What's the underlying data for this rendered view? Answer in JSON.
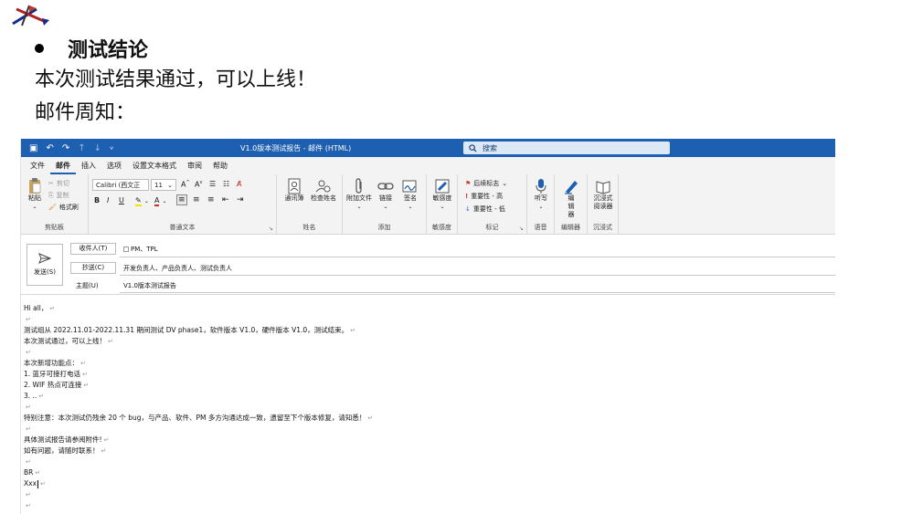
{
  "slide": {
    "bullet": "测试结论",
    "line1": "本次测试结果通过，可以上线！",
    "line2": "邮件周知："
  },
  "window": {
    "title": "V1.0版本测试报告 - 邮件 (HTML)",
    "search_placeholder": "搜索",
    "titlebar_color": "#1d5fb0"
  },
  "menu": {
    "tabs": [
      "文件",
      "邮件",
      "插入",
      "选项",
      "设置文本格式",
      "审阅",
      "帮助"
    ],
    "active": "邮件"
  },
  "ribbon": {
    "clipboard": {
      "paste": "粘贴",
      "cut": "剪切",
      "copy": "复制",
      "format_painter": "格式刷",
      "label": "剪贴板"
    },
    "font": {
      "font_name": "Calibri (西文正",
      "font_size": "11",
      "label": "普通文本"
    },
    "names": {
      "address_book": "通讯簿",
      "check_names": "检查姓名",
      "label": "姓名"
    },
    "include": {
      "attach": "附加文件",
      "link": "链接",
      "signature": "签名",
      "label": "添加"
    },
    "sensitivity": {
      "button": "敏感度",
      "label": "敏感度"
    },
    "tags": {
      "follow_up": "后续标志",
      "high": "重要性 - 高",
      "low": "重要性 - 低",
      "label": "标记"
    },
    "voice": {
      "dictate": "听写",
      "label": "语音"
    },
    "editor": {
      "button": "编辑器",
      "label": "编辑器"
    },
    "immersive": {
      "button": "沉浸式阅读器",
      "label": "沉浸式"
    }
  },
  "compose": {
    "send": "发送(S)",
    "to_label": "收件人(T)",
    "to_value": "PM、TPL",
    "cc_label": "抄送(C)",
    "cc_value": "开发负责人、产品负责人、测试负责人",
    "subject_label": "主题(U)",
    "subject_value": "V1.0版本测试报告"
  },
  "body": {
    "lines": [
      "Hi all，",
      "",
      "测试组从 2022.11.01-2022.11.31 期间测试 DV phase1，软件版本 V1.0，硬件版本 V1.0，测试结束。",
      "本次测试通过，可以上线！",
      "",
      "本次新增功能点：",
      "1.    蓝牙可接打电话",
      "2.    WIF 热点可连接",
      "3.    ..",
      "",
      "特别注意：本次测试仍残余 20 个 bug，与产品、软件、PM 多方沟通达成一致，遗留至下个版本修复，请知悉！",
      "",
      "具体测试报告请参阅附件!",
      "如有问题，请随时联系！",
      "",
      "BR",
      "Xxx",
      "",
      ""
    ]
  }
}
